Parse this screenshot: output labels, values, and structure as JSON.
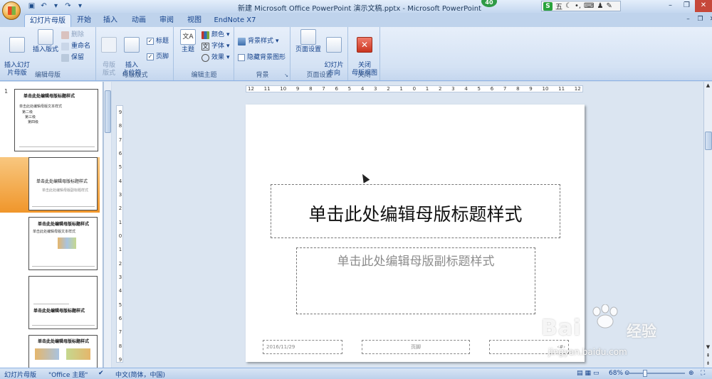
{
  "window": {
    "title": "新建 Microsoft Office PowerPoint 演示文稿.pptx - Microsoft PowerPoint",
    "badge": "40",
    "ime_label": "五"
  },
  "tabs": [
    {
      "label": "幻灯片母版",
      "active": true
    },
    {
      "label": "开始"
    },
    {
      "label": "插入"
    },
    {
      "label": "动画"
    },
    {
      "label": "审阅"
    },
    {
      "label": "视图"
    },
    {
      "label": "EndNote X7"
    }
  ],
  "ribbon": {
    "edit_master": {
      "label": "编辑母版",
      "insert_slide_master": "插入幻灯\n片母版",
      "insert_layout": "插入版式",
      "delete": "删除",
      "rename": "重命名",
      "preserve": "保留"
    },
    "master_layout": {
      "label": "母版版式",
      "master_layout_btn": "母版\n版式",
      "insert_placeholder": "插入\n占位符",
      "title_check": "标题",
      "footer_check": "页脚"
    },
    "edit_theme": {
      "label": "编辑主题",
      "theme": "主题",
      "colors": "颜色",
      "fonts": "字体",
      "effects": "效果"
    },
    "background": {
      "label": "背景",
      "background_styles": "背景样式",
      "hide_background": "隐藏背景图形"
    },
    "page_setup": {
      "label": "页面设置",
      "page_setup_btn": "页面设置",
      "orientation": "幻灯片\n方向"
    },
    "close": {
      "label": "关闭",
      "close_master": "关闭\n母版视图"
    }
  },
  "thumbnails": {
    "slide_number": "1",
    "master_title": "单击此处编辑母版标题样式",
    "master_text": "单击此处编辑母版文本样式",
    "level2": "第二级",
    "level3": "第三级",
    "level4": "第四级",
    "layout1_title": "单击此处编辑母版标题样式",
    "layout1_sub": "单击此处编辑母版副标题样式",
    "layout2_title": "单击此处编辑母版标题样式",
    "layout2_text": "单击此处编辑母版文本样式",
    "layout3_title": "单击此处编辑母版标题样式",
    "layout4_title": "单击此处编辑母版标题样式"
  },
  "ruler": {
    "horizontal": [
      "12",
      "11",
      "10",
      "9",
      "8",
      "7",
      "6",
      "5",
      "4",
      "3",
      "2",
      "1",
      "0",
      "1",
      "2",
      "3",
      "4",
      "5",
      "6",
      "7",
      "8",
      "9",
      "10",
      "11",
      "12"
    ],
    "vertical": [
      "9",
      "8",
      "7",
      "6",
      "5",
      "4",
      "3",
      "2",
      "1",
      "0",
      "1",
      "2",
      "3",
      "4",
      "5",
      "6",
      "7",
      "8",
      "9"
    ]
  },
  "slide": {
    "title": "单击此处编辑母版标题样式",
    "subtitle": "单击此处编辑母版副标题样式",
    "date": "2016/11/29",
    "footer": "页脚",
    "page_number": "‹#›"
  },
  "watermark": {
    "brand": "Bai",
    "brand2": "经验",
    "url": "jingyan.baidu.com"
  },
  "status": {
    "view": "幻灯片母版",
    "theme": "\"Office 主题\"",
    "language": "中文(简体，中国)",
    "zoom": "68%",
    "zoom_value": 68
  }
}
